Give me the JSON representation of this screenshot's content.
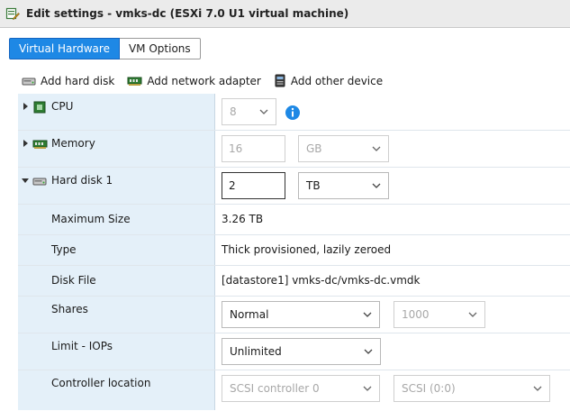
{
  "window": {
    "title": "Edit settings - vmks-dc (ESXi 7.0 U1 virtual machine)"
  },
  "tabs": [
    {
      "label": "Virtual Hardware",
      "active": true
    },
    {
      "label": "VM Options",
      "active": false
    }
  ],
  "toolbar": {
    "add_hard_disk": "Add hard disk",
    "add_network_adapter": "Add network adapter",
    "add_other_device": "Add other device"
  },
  "rows": {
    "cpu": {
      "label": "CPU",
      "value": "8"
    },
    "memory": {
      "label": "Memory",
      "value": "16",
      "unit": "GB"
    },
    "hard_disk": {
      "label": "Hard disk 1",
      "value": "2",
      "unit": "TB"
    },
    "maximum_size": {
      "label": "Maximum Size",
      "value": "3.26 TB"
    },
    "type": {
      "label": "Type",
      "value": "Thick provisioned, lazily zeroed"
    },
    "disk_file": {
      "label": "Disk File",
      "value": "[datastore1] vmks-dc/vmks-dc.vmdk"
    },
    "shares": {
      "label": "Shares",
      "value": "Normal",
      "amount": "1000"
    },
    "limit_iops": {
      "label": "Limit - IOPs",
      "value": "Unlimited"
    },
    "controller": {
      "label": "Controller location",
      "controller": "SCSI controller 0",
      "slot": "SCSI (0:0)"
    }
  },
  "colors": {
    "accent": "#1e88e5",
    "label_bg": "#e4f0f9",
    "info": "#1e88e5"
  }
}
